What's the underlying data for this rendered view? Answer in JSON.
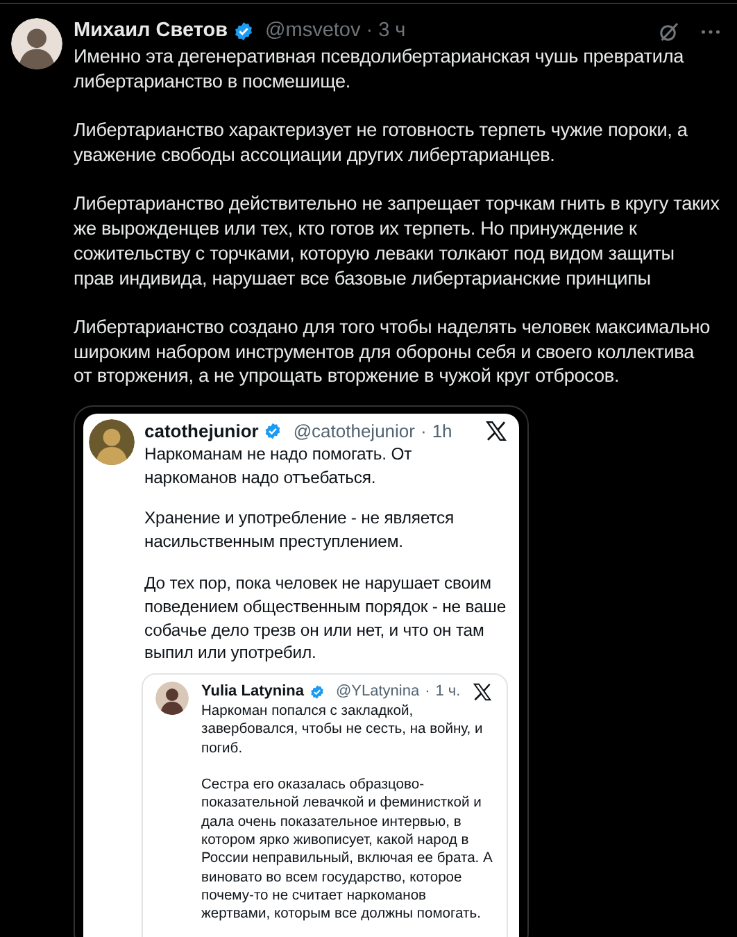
{
  "post": {
    "author": {
      "name": "Михаил Светов",
      "verified": true,
      "handle": "@msvetov",
      "separator": "·",
      "time": "3 ч"
    },
    "paragraphs": [
      "Именно эта дегенеративная псевдолибертарианская чушь превратила\nлибертарианство в посмешище.",
      "Либертарианство характеризует не готовность терпеть чужие пороки, а\nуважение свободы ассоциации других либертарианцев.",
      "Либертарианство действительно не запрещает торчкам гнить в кругу таких\nже вырожденцев или тех, кто готов их терпеть. Но принуждение к\nсожительству с торчками, которую леваки толкают под видом защиты\nправ индивида, нарушает все базовые либертарианские принципы",
      "Либертарианство создано для того чтобы наделять человек максимально\nшироким набором инструментов для обороны себя и своего коллектива\nот вторжения, а не упрощать вторжение в чужой круг отбросов."
    ],
    "screenshot": {
      "author": {
        "name": "catothejunior",
        "verified": true,
        "handle": "@catothejunior",
        "separator": "·",
        "time": "1h"
      },
      "paragraphs": [
        "Наркоманам не надо помогать. От\nнаркоманов надо отъебаться.",
        "Хранение и употребление - не является\nнасильственным преступлением.",
        "До тех пор, пока человек не нарушает своим\nповедением общественным порядок - не ваше\nсобачье дело трезв он или нет, и что он там\nвыпил или употребил."
      ],
      "quoted": {
        "author": {
          "name": "Yulia Latynina",
          "verified": true,
          "handle": "@YLatynina",
          "separator": "·",
          "time": "1 ч."
        },
        "paragraphs": [
          "Наркоман попался с закладкой,\nзавербовался, чтобы не сесть, на войну, и\nпогиб.",
          "Сестра его оказалась образцово-\nпоказательной левачкой и феминисткой и\nдала очень показательное интервью, в\nкотором ярко живописует, какой народ в\nРоссии неправильный, включая ее брата.  А\nвиновато во всем государство, которое\nпочему-то не считает наркоманов\nжертвами, которым все должны помогать."
        ]
      }
    }
  }
}
